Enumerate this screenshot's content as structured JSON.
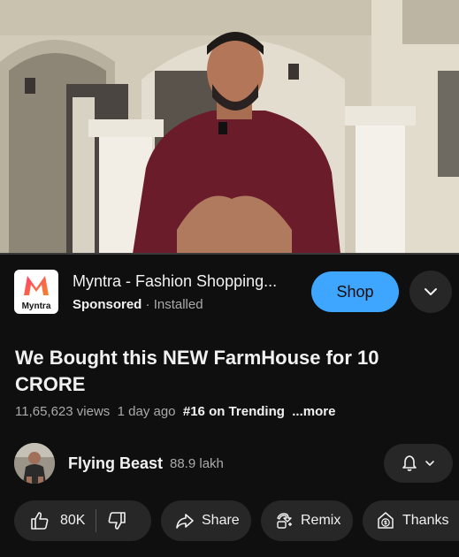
{
  "player": {
    "progress_fraction": 0
  },
  "ad": {
    "brand_logo_text": "Myntra",
    "title": "Myntra - Fashion Shopping...",
    "sponsored_label": "Sponsored",
    "separator": "·",
    "installed_label": "Installed",
    "shop_label": "Shop"
  },
  "video": {
    "title": "We Bought this NEW FarmHouse for 10 CRORE",
    "views": "11,65,623 views",
    "age": "1 day ago",
    "trending": "#16 on Trending",
    "more": "...more"
  },
  "channel": {
    "name": "Flying Beast",
    "subscribers": "88.9 lakh"
  },
  "actions": {
    "likes": "80K",
    "share": "Share",
    "remix": "Remix",
    "thanks": "Thanks"
  },
  "colors": {
    "background": "#0f0f0f",
    "shop_button": "#3ea6ff",
    "pill": "#272727",
    "progress": "#ff0000"
  },
  "icons": [
    "myntra-logo",
    "chevron-down-icon",
    "bell-icon",
    "thumbs-up-icon",
    "thumbs-down-icon",
    "share-icon",
    "remix-icon",
    "thanks-icon"
  ]
}
